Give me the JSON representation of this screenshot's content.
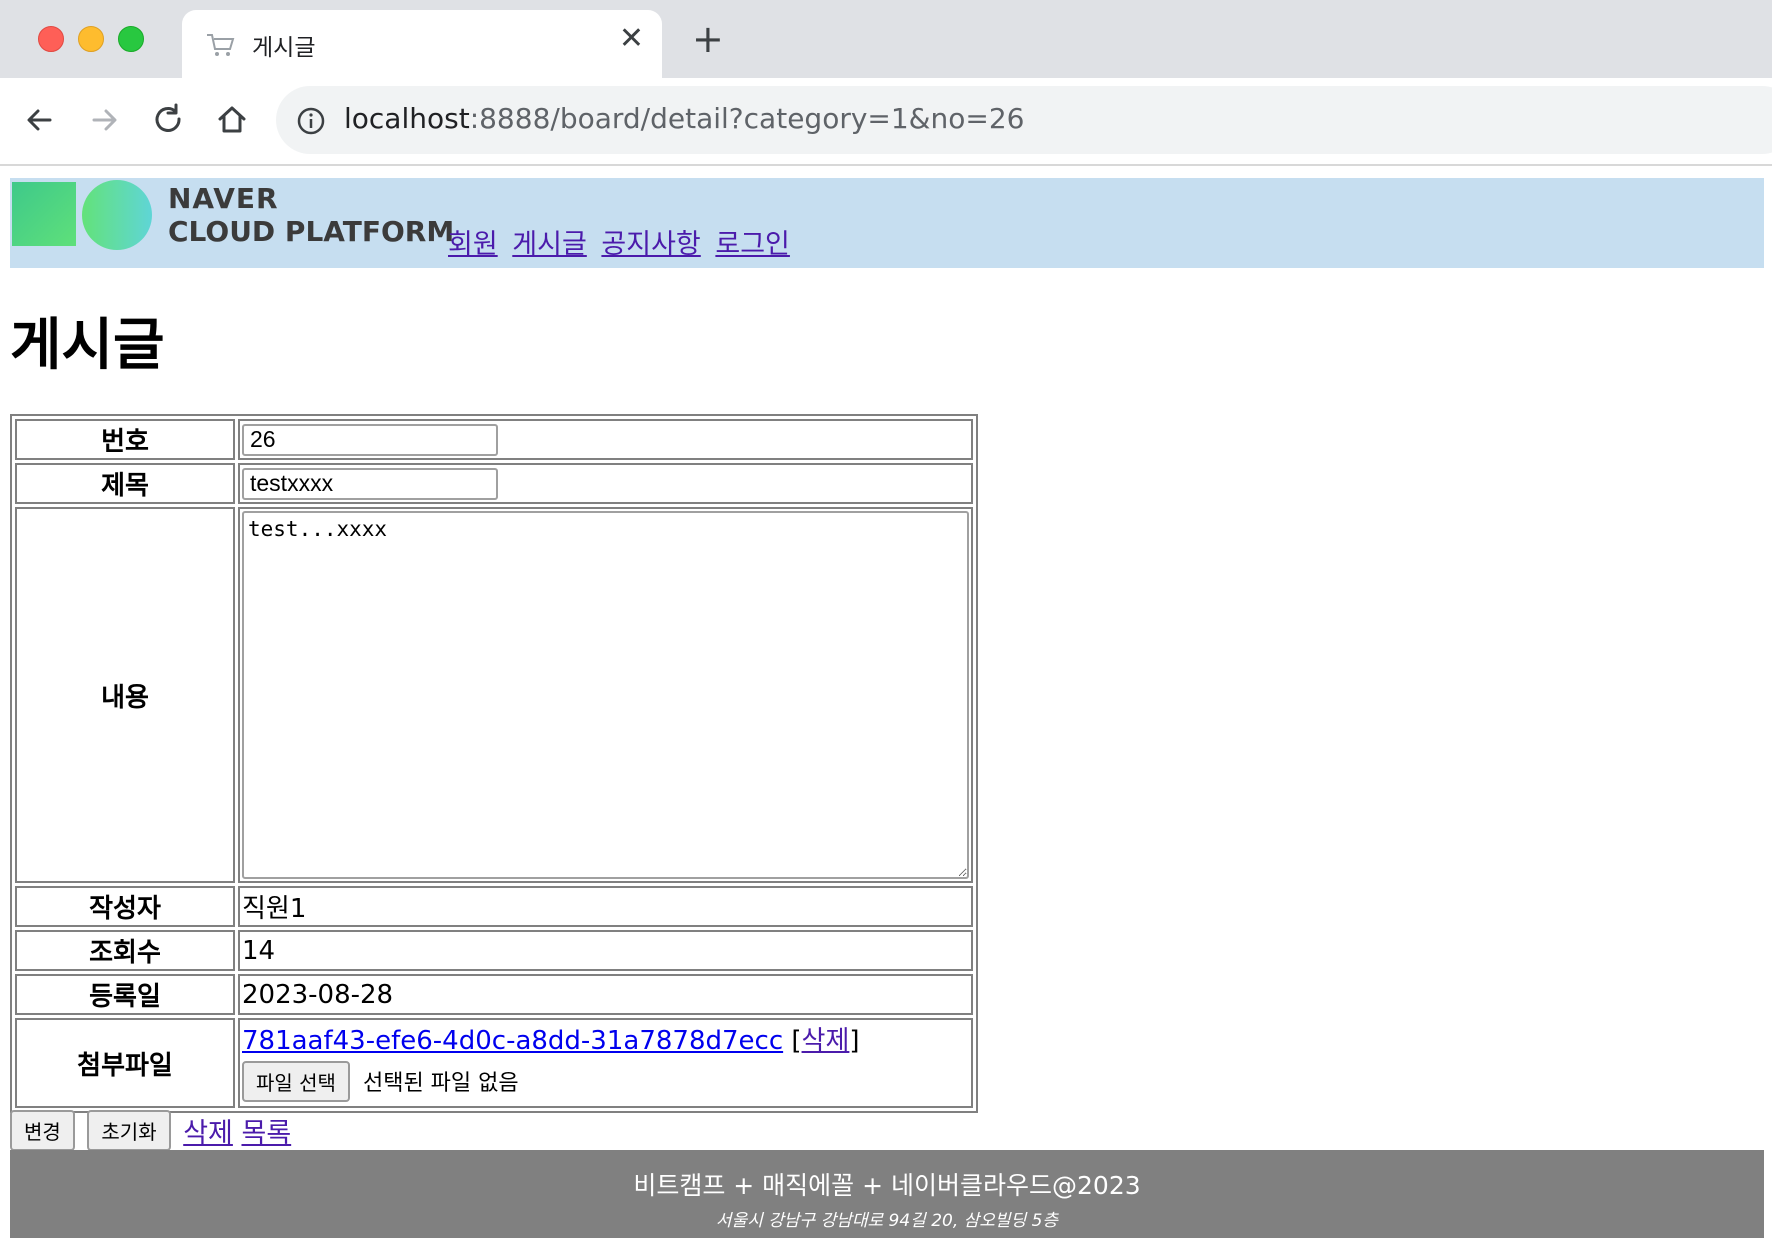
{
  "browser": {
    "tab_title": "게시글",
    "url_host": "localhost",
    "url_rest": ":8888/board/detail?category=1&no=26"
  },
  "header": {
    "logo_line1": "NAVER",
    "logo_line2": "CLOUD PLATFORM",
    "nav": [
      "회원",
      "게시글",
      "공지사항",
      "로그인"
    ]
  },
  "page_title": "게시글",
  "form": {
    "no_label": "번호",
    "no_value": "26",
    "title_label": "제목",
    "title_value": "testxxxx",
    "content_label": "내용",
    "content_value": "test...xxxx",
    "writer_label": "작성자",
    "writer_value": "직원1",
    "views_label": "조회수",
    "views_value": "14",
    "date_label": "등록일",
    "date_value": "2023-08-28",
    "attach_label": "첨부파일",
    "attach_file": "781aaf43-efe6-4d0c-a8dd-31a7878d7ecc",
    "attach_delete": "삭제",
    "file_button": "파일 선택",
    "file_none": "선택된 파일 없음"
  },
  "actions": {
    "update": "변경",
    "reset": "초기화",
    "delete": "삭제",
    "list": "목록"
  },
  "footer": {
    "main": "비트캠프 + 매직에꼴 + 네이버클라우드@2023",
    "address": "서울시 강남구 강남대로 94길 20, 삼오빌딩 5층"
  }
}
